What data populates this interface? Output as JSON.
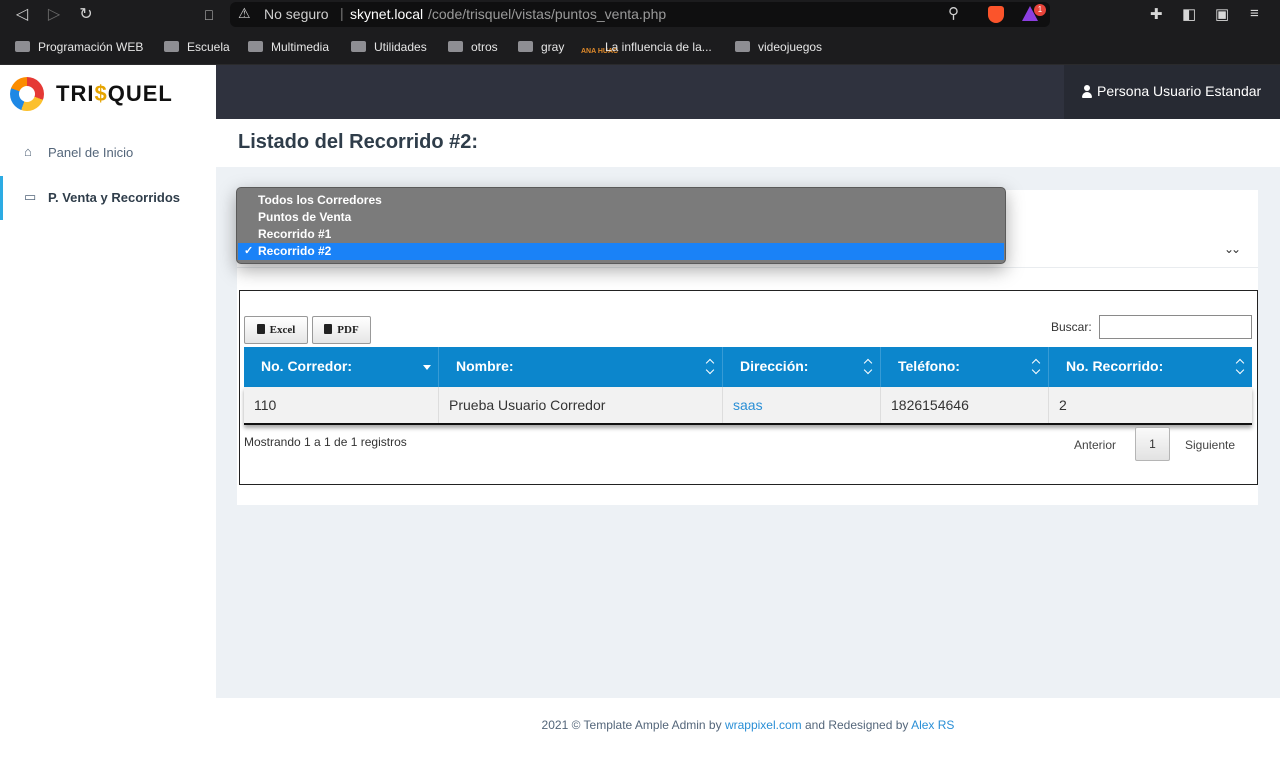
{
  "browser": {
    "security_label": "No seguro",
    "url_host": "skynet.local",
    "url_path": "/code/trisquel/vistas/puntos_venta.php",
    "rewards_badge": "1",
    "bookmarks": [
      "Programación WEB",
      "Escuela",
      "Multimedia",
      "Utilidades",
      "otros",
      "gray",
      "La influencia de la...",
      "videojuegos"
    ],
    "bookmark_icon_text": "ANA HUAC"
  },
  "sidebar": {
    "logo_part1": "TRI",
    "logo_dollar": "$",
    "logo_part2": "QUEL",
    "items": [
      {
        "label": "Panel de Inicio",
        "icon": "home-icon"
      },
      {
        "label": "P. Venta y Recorridos",
        "icon": "monitor-icon"
      }
    ]
  },
  "header": {
    "user_name": "Persona Usuario Estandar"
  },
  "page": {
    "title": "Listado del Recorrido #2:"
  },
  "select": {
    "options": [
      "Todos los Corredores",
      "Puntos de Venta",
      "Recorrido #1",
      "Recorrido #2"
    ],
    "selected": "Recorrido #2",
    "check": "✓"
  },
  "table": {
    "buttons": {
      "excel": "Excel",
      "pdf": "PDF"
    },
    "search_label": "Buscar:",
    "search_value": "",
    "columns": [
      "No. Corredor:",
      "Nombre:",
      "Dirección:",
      "Teléfono:",
      "No. Recorrido:"
    ],
    "rows": [
      [
        "110",
        "Prueba Usuario Corredor",
        "saas",
        "1826154646",
        "2"
      ]
    ],
    "info": "Mostrando 1 a 1 de 1 registros",
    "pagination": {
      "prev": "Anterior",
      "current": "1",
      "next": "Siguiente"
    }
  },
  "footer": {
    "text1": "2021 © Template Ample Admin by ",
    "link1": "wrappixel.com",
    "text2": " and Redesigned by ",
    "link2": "Alex RS"
  },
  "colors": {
    "accent": "#0c86cc",
    "sidebar_active": "#2cabe3",
    "topbar": "#2f323e",
    "select_highlight": "#1a82f7"
  }
}
